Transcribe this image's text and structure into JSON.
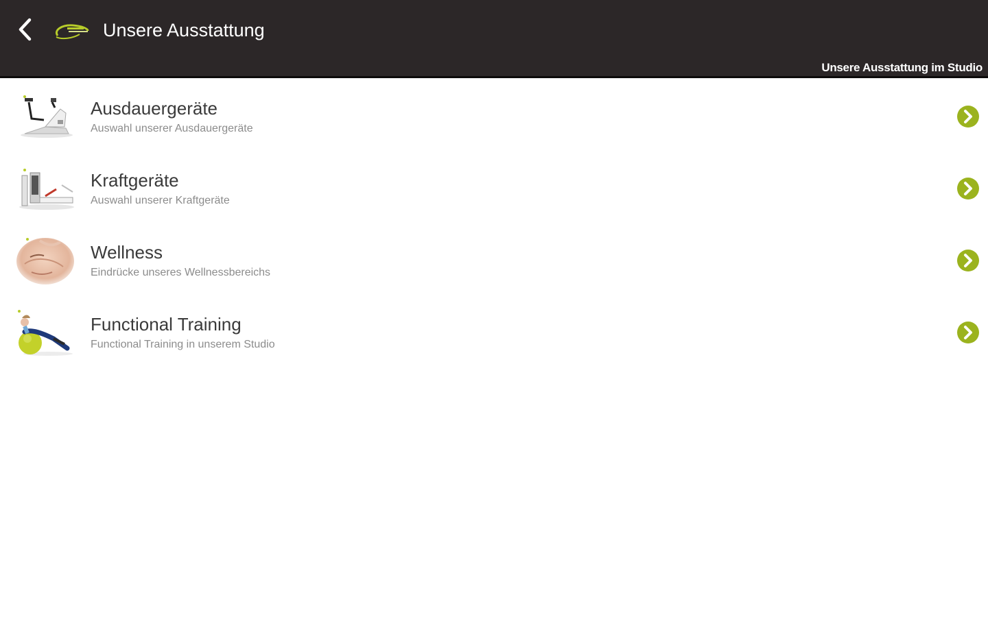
{
  "header": {
    "title": "Unsere Ausstattung",
    "subtitle": "Unsere Ausstattung im Studio",
    "back_icon": "chevron-left-icon",
    "logo_icon": "brand-logo-swoosh"
  },
  "colors": {
    "header_bg": "#2c2728",
    "accent": "#9bb31e",
    "title_text": "#3a3a3a",
    "desc_text": "#8c8c8c"
  },
  "items": [
    {
      "title": "Ausdauergeräte",
      "description": "Auswahl unserer Ausdauergeräte",
      "icon": "exercise-bike-image"
    },
    {
      "title": "Kraftgeräte",
      "description": "Auswahl unserer Kraftgeräte",
      "icon": "weight-machine-image"
    },
    {
      "title": "Wellness",
      "description": "Eindrücke unseres Wellnessbereichs",
      "icon": "wellness-face-image"
    },
    {
      "title": "Functional Training",
      "description": "Functional Training in unserem Studio",
      "icon": "fitness-ball-image"
    }
  ]
}
